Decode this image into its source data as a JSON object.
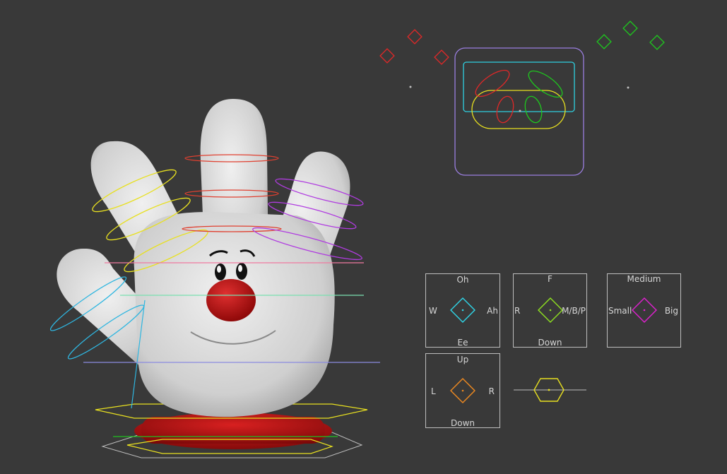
{
  "viewport": {
    "background": "#393939"
  },
  "face_controls": {
    "eye_left_color": "#e02828",
    "eye_right_color": "#1ec81e",
    "brow_outline_color": "#9b7fe0",
    "frame_color": "#2fd0e0",
    "mouth_color": "#e8e020"
  },
  "slider_panels": {
    "mouth_shape": {
      "top": "Oh",
      "left": "W",
      "right": "Ah",
      "bottom": "Ee",
      "color": "#2fd6e8"
    },
    "lip_shape": {
      "top": "F",
      "left": "R",
      "right": "M/B/P",
      "bottom": "Down",
      "color": "#8fe020"
    },
    "size": {
      "top": "Medium",
      "left": "Small",
      "right": "Big",
      "color": "#e020d0"
    },
    "direction": {
      "top": "Up",
      "left": "L",
      "right": "R",
      "bottom": "Down",
      "color": "#f08a20"
    },
    "hex_slider": {
      "color": "#e8e020"
    }
  },
  "character": {
    "glove_color": "#dcdcdc",
    "nose_color": "#c81010",
    "shoe_color": "#c81414"
  }
}
